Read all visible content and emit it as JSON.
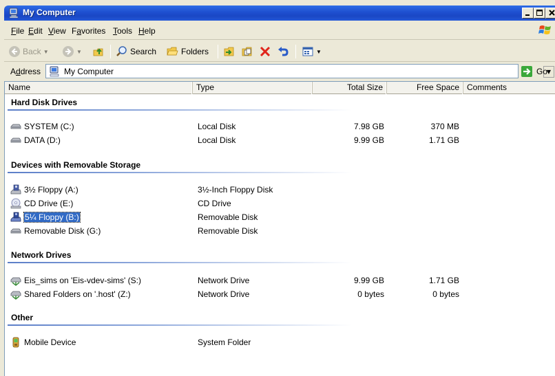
{
  "window": {
    "title": "My Computer",
    "icon": "my-computer-icon"
  },
  "menu": [
    {
      "id": "file",
      "pre": "",
      "u": "F",
      "post": "ile"
    },
    {
      "id": "edit",
      "pre": "",
      "u": "E",
      "post": "dit"
    },
    {
      "id": "view",
      "pre": "",
      "u": "V",
      "post": "iew"
    },
    {
      "id": "favorites",
      "pre": "F",
      "u": "a",
      "post": "vorites"
    },
    {
      "id": "tools",
      "pre": "",
      "u": "T",
      "post": "ools"
    },
    {
      "id": "help",
      "pre": "",
      "u": "H",
      "post": "elp"
    }
  ],
  "toolbar": {
    "back_label": "Back",
    "search_label": "Search",
    "folders_label": "Folders"
  },
  "address": {
    "label_underlined": "d",
    "label_pre": "A",
    "label_post": "dress",
    "value": "My Computer",
    "go_label": "Go"
  },
  "columns": {
    "name": "Name",
    "type": "Type",
    "total_size": "Total Size",
    "free_space": "Free Space",
    "comments": "Comments"
  },
  "groups": [
    {
      "title": "Hard Disk Drives",
      "items": [
        {
          "name": "SYSTEM (C:)",
          "type": "Local Disk",
          "total": "7.98 GB",
          "free": "370 MB",
          "icon": "hard-drive-icon"
        },
        {
          "name": "DATA (D:)",
          "type": "Local Disk",
          "total": "9.99 GB",
          "free": "1.71 GB",
          "icon": "hard-drive-icon"
        }
      ]
    },
    {
      "title": "Devices with Removable Storage",
      "items": [
        {
          "name": "3½ Floppy (A:)",
          "type": "3½-Inch Floppy Disk",
          "total": "",
          "free": "",
          "icon": "floppy-drive-icon"
        },
        {
          "name": "CD Drive (E:)",
          "type": "CD Drive",
          "total": "",
          "free": "",
          "icon": "cd-drive-icon"
        },
        {
          "name": "5¼ Floppy (B:)",
          "type": "Removable Disk",
          "total": "",
          "free": "",
          "icon": "floppy-drive-icon",
          "selected": true
        },
        {
          "name": "Removable Disk (G:)",
          "type": "Removable Disk",
          "total": "",
          "free": "",
          "icon": "removable-disk-icon"
        }
      ]
    },
    {
      "title": "Network Drives",
      "items": [
        {
          "name": "Eis_sims on 'Eis-vdev-sims' (S:)",
          "type": "Network Drive",
          "total": "9.99 GB",
          "free": "1.71 GB",
          "icon": "network-drive-icon"
        },
        {
          "name": "Shared Folders on '.host' (Z:)",
          "type": "Network Drive",
          "total": "0 bytes",
          "free": "0 bytes",
          "icon": "network-drive-icon"
        }
      ]
    },
    {
      "title": "Other",
      "items": [
        {
          "name": "Mobile Device",
          "type": "System Folder",
          "total": "",
          "free": "",
          "icon": "mobile-device-icon"
        }
      ]
    }
  ],
  "colors": {
    "titlebar": "#1e4fcf",
    "selection": "#316ac5",
    "chrome": "#ece9d8"
  }
}
